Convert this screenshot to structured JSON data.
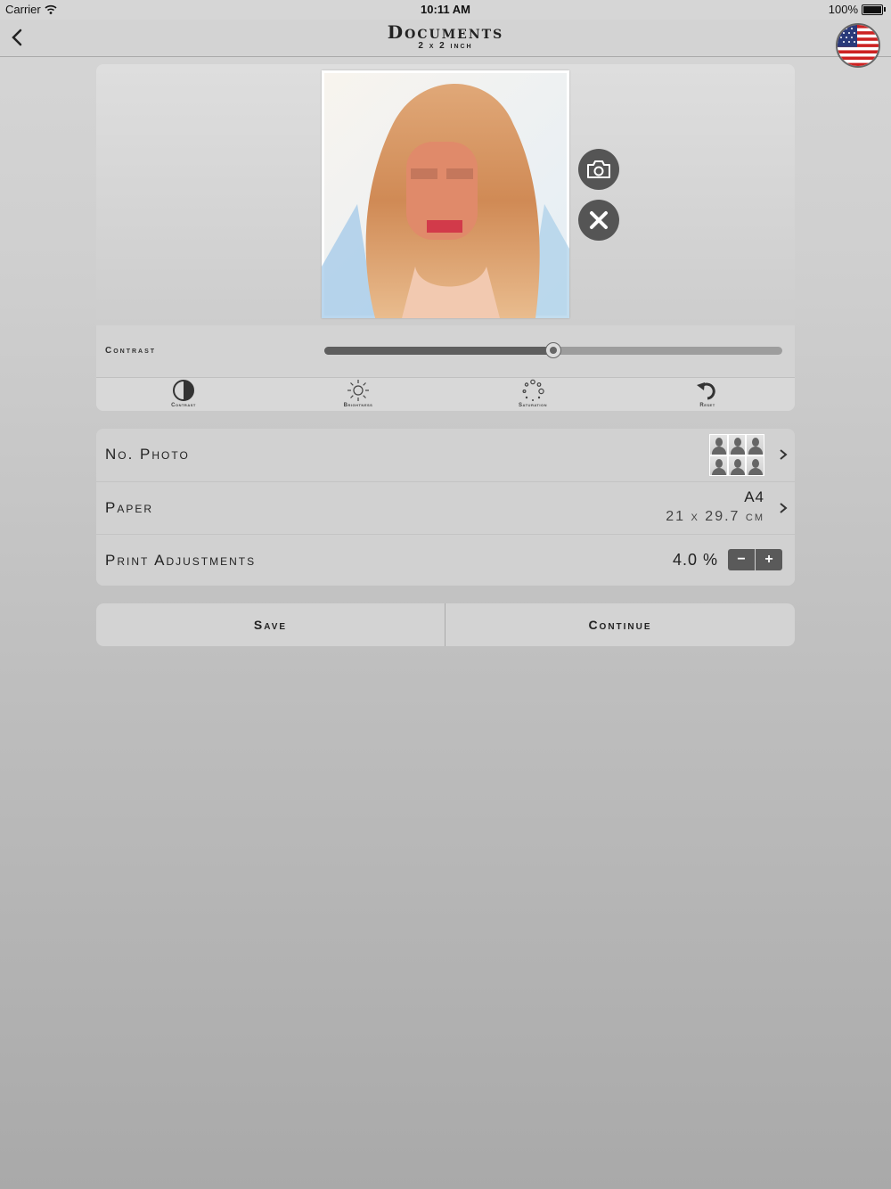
{
  "status_bar": {
    "carrier": "Carrier",
    "time": "10:11 AM",
    "battery": "100%"
  },
  "nav": {
    "title": "Documents",
    "subtitle": "2 x 2 inch",
    "flag_icon": "us-flag-icon"
  },
  "editor": {
    "slider_label": "Contrast",
    "slider_value": 0.5,
    "tools": [
      {
        "label": "Contrast",
        "icon": "contrast-icon"
      },
      {
        "label": "Brightness",
        "icon": "sun-icon"
      },
      {
        "label": "Saturation",
        "icon": "dots-circle-icon"
      },
      {
        "label": "Reset",
        "icon": "reset-icon"
      }
    ]
  },
  "settings": {
    "photo_count_label": "No. Photo",
    "paper_label": "Paper",
    "paper_format": "A4",
    "paper_size": "21 x 29.7 cm",
    "print_adjust_label": "Print Adjustments",
    "print_adjust_value": "4.0 %",
    "minus": "−",
    "plus": "+"
  },
  "actions": {
    "save": "Save",
    "continue": "Continue"
  },
  "colors": {
    "dark_button": "#555555",
    "slider_fill": "#5e5e5e",
    "slider_track": "#9d9d9d"
  }
}
